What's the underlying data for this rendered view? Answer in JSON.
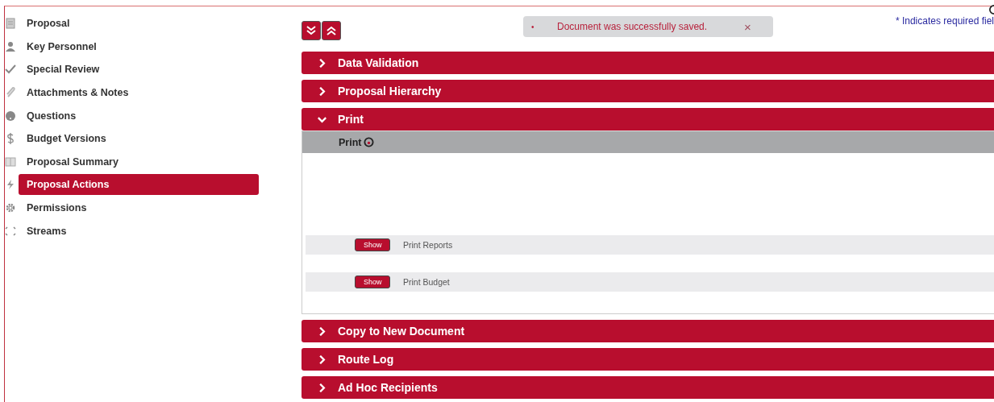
{
  "sidebar": {
    "items": [
      {
        "label": "Proposal",
        "selected": false
      },
      {
        "label": "Key Personnel",
        "selected": false
      },
      {
        "label": "Special Review",
        "selected": false
      },
      {
        "label": "Attachments & Notes",
        "selected": false
      },
      {
        "label": "Questions",
        "selected": false
      },
      {
        "label": "Budget Versions",
        "selected": false
      },
      {
        "label": "Proposal Summary",
        "selected": false
      },
      {
        "label": "Proposal Actions",
        "selected": true
      },
      {
        "label": "Permissions",
        "selected": false
      },
      {
        "label": "Streams",
        "selected": false
      }
    ]
  },
  "message": {
    "bullet": "•",
    "text": "Document was successfully saved.",
    "close": "×"
  },
  "required_note": "* Indicates required fiel",
  "sections": [
    {
      "title": "Data Validation",
      "expanded": false
    },
    {
      "title": "Proposal Hierarchy",
      "expanded": false
    },
    {
      "title": "Print",
      "expanded": true,
      "subheader": "Print",
      "rows": [
        {
          "button": "Show",
          "label": "Print Reports"
        },
        {
          "button": "Show",
          "label": "Print Budget"
        }
      ]
    },
    {
      "title": "Copy to New Document",
      "expanded": false
    },
    {
      "title": "Route Log",
      "expanded": false
    },
    {
      "title": "Ad Hoc Recipients",
      "expanded": false
    }
  ]
}
